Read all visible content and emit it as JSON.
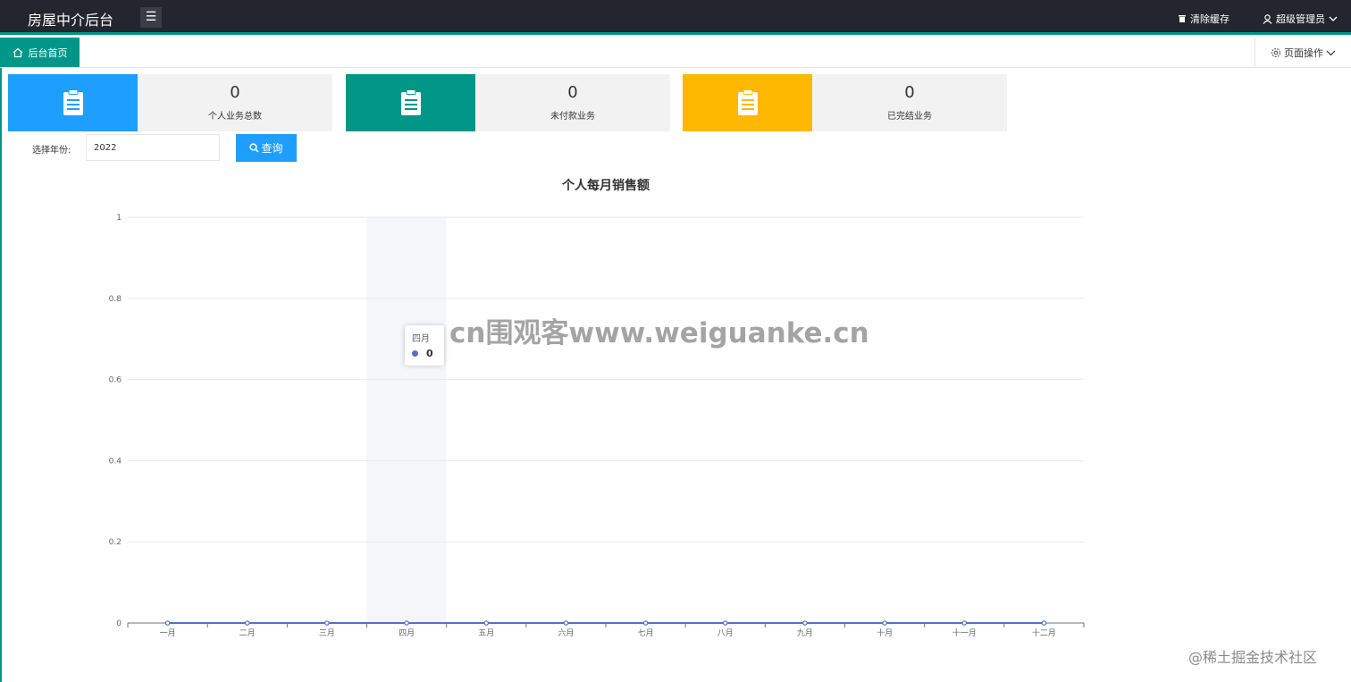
{
  "header": {
    "app_title": "房屋中介后台",
    "menu_icon": "hamburger-icon",
    "clear_cache": "清除缓存",
    "user": "超级管理员"
  },
  "tabs": {
    "home": "后台首页",
    "page_ops": "页面操作"
  },
  "colors": {
    "blue": "#1e9fff",
    "green": "#009688",
    "yellow": "#ffb800",
    "series": "#5470c6"
  },
  "cards": [
    {
      "icon": "clipboard-icon",
      "value": "0",
      "label": "个人业务总数"
    },
    {
      "icon": "clipboard-icon",
      "value": "0",
      "label": "未付款业务"
    },
    {
      "icon": "clipboard-icon",
      "value": "0",
      "label": "已完结业务"
    }
  ],
  "filter": {
    "year_label": "选择年份:",
    "year_value": "2022",
    "query_label": "查询"
  },
  "tooltip": {
    "category": "四月",
    "value": "0"
  },
  "watermark": "cn围观客www.weiguanke.cn",
  "corner_watermark": "@稀土掘金技术社区",
  "chart_data": {
    "type": "line",
    "title": "个人每月销售额",
    "categories": [
      "一月",
      "二月",
      "三月",
      "四月",
      "五月",
      "六月",
      "七月",
      "八月",
      "九月",
      "十月",
      "十一月",
      "十二月"
    ],
    "series": [
      {
        "values": [
          0,
          0,
          0,
          0,
          0,
          0,
          0,
          0,
          0,
          0,
          0,
          0
        ]
      }
    ],
    "ylim": [
      0,
      1
    ],
    "yticks": [
      "0",
      "0.2",
      "0.4",
      "0.6",
      "0.8",
      "1"
    ],
    "highlighted_category": "四月",
    "grid": true
  }
}
